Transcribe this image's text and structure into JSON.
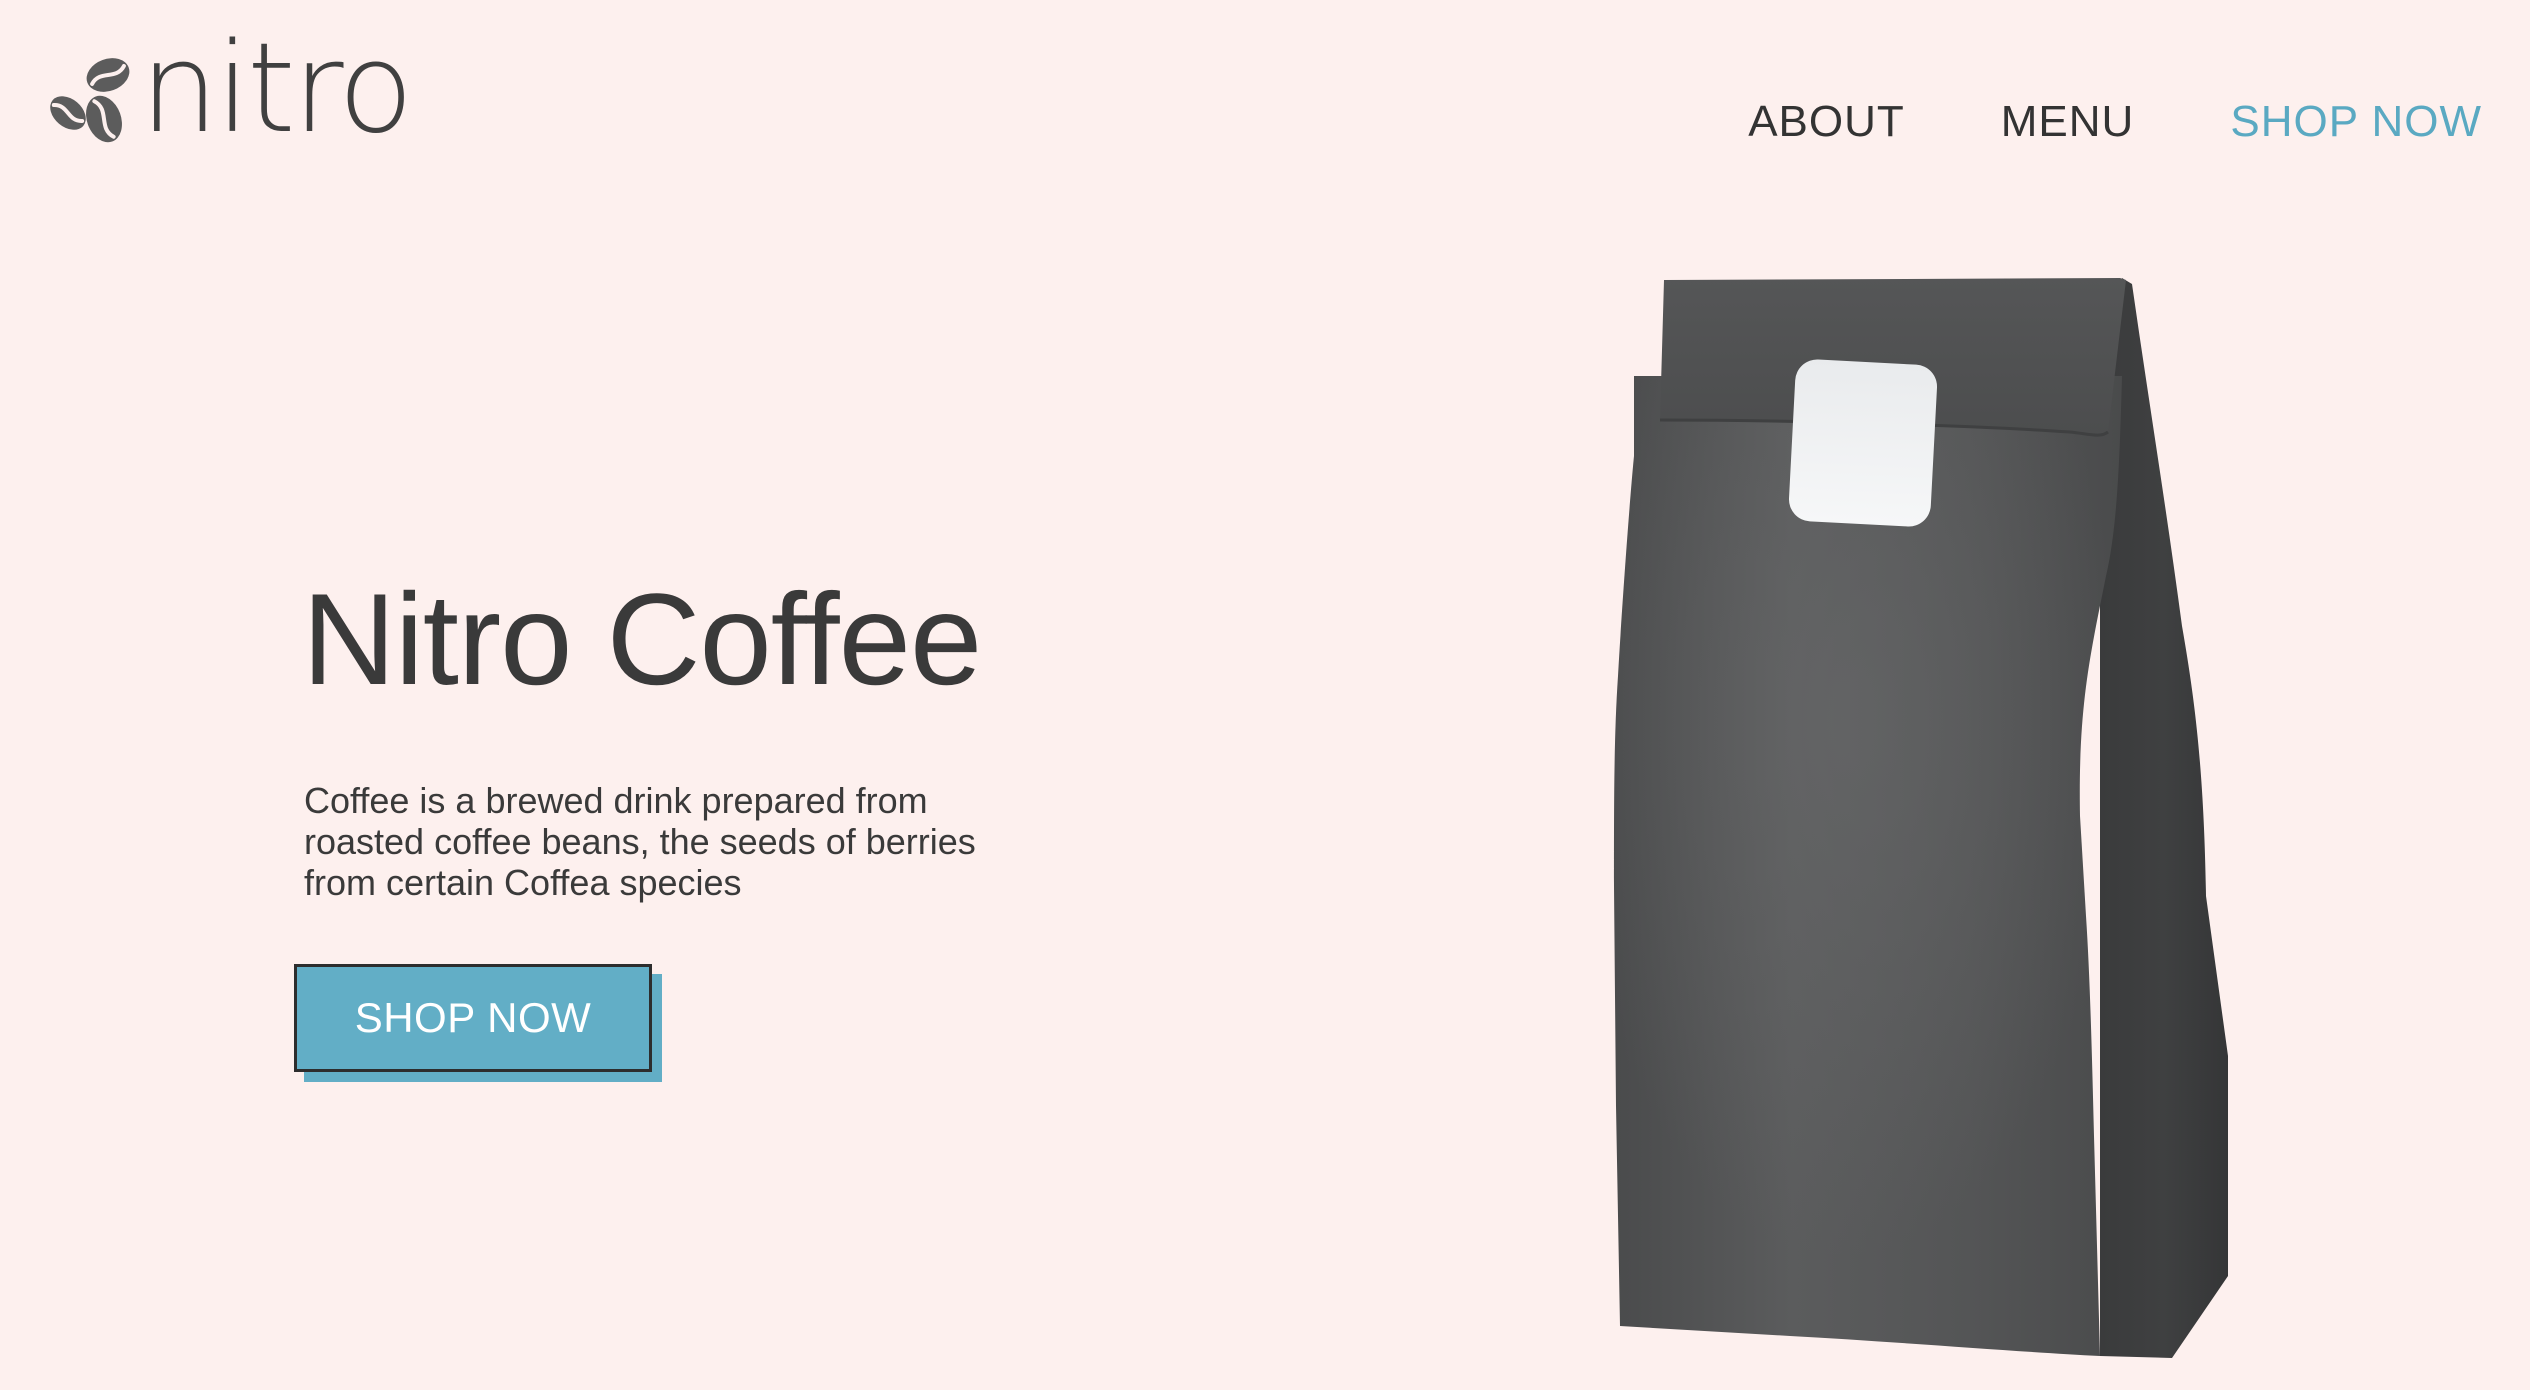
{
  "brand": {
    "logo_text": "nitro",
    "logo_icon": "coffee-beans-icon"
  },
  "nav": {
    "items": [
      {
        "label": "ABOUT",
        "active": false
      },
      {
        "label": "MENU",
        "active": false
      },
      {
        "label": "SHOP NOW",
        "active": true
      }
    ]
  },
  "hero": {
    "title": "Nitro Coffee",
    "description": "Coffee is a brewed drink prepared from roasted coffee beans, the seeds of berries from certain Coffea species",
    "cta_label": "SHOP NOW"
  },
  "product": {
    "image": "coffee-bag-icon"
  },
  "colors": {
    "background": "#fdf0ee",
    "accent": "#62aec6",
    "text": "#3a3a3a",
    "bag": "#4e4f50"
  }
}
